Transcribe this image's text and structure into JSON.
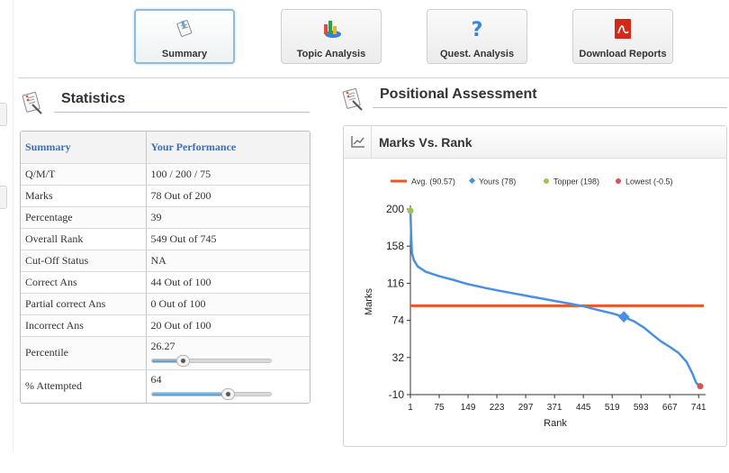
{
  "nav": [
    {
      "label": "Summary",
      "icon": "summary-icon",
      "active": true
    },
    {
      "label": "Topic Analysis",
      "icon": "topic-chart-icon",
      "active": false
    },
    {
      "label": "Quest. Analysis",
      "icon": "question-mark-icon",
      "active": false
    },
    {
      "label": "Download Reports",
      "icon": "pdf-icon",
      "active": false
    }
  ],
  "statistics": {
    "title": "Statistics",
    "header": {
      "col1": "Summary",
      "col2": "Your Performance"
    },
    "rows": [
      {
        "label": "Q/M/T",
        "value": "100 / 200 / 75"
      },
      {
        "label": "Marks",
        "value": "78 Out of 200"
      },
      {
        "label": "Percentage",
        "value": "39"
      },
      {
        "label": "Overall Rank",
        "value": "549 Out of 745"
      },
      {
        "label": "Cut-Off Status",
        "value": "NA"
      },
      {
        "label": "Correct Ans",
        "value": "44 Out of 100"
      },
      {
        "label": "Partial correct Ans",
        "value": "0 Out of 100"
      },
      {
        "label": "Incorrect Ans",
        "value": "20 Out of 100"
      }
    ],
    "sliders": [
      {
        "label": "Percentile",
        "value": "26.27",
        "fraction": 0.2627
      },
      {
        "label": "% Attempted",
        "value": "64",
        "fraction": 0.64
      }
    ]
  },
  "positional": {
    "title": "Positional Assessment",
    "panel_title": "Marks Vs. Rank"
  },
  "colors": {
    "avg": "#e8562a",
    "yours": "#4a8fe0",
    "topper": "#9cc35a",
    "lowest": "#d9534f",
    "link": "#3b6fb8"
  },
  "chart_data": {
    "type": "line",
    "xlabel": "Rank",
    "ylabel": "Marks",
    "xlim": [
      1,
      745
    ],
    "ylim": [
      -10,
      200
    ],
    "x_ticks": [
      "1",
      "75",
      "149",
      "223",
      "297",
      "371",
      "445",
      "519",
      "593",
      "667",
      "741"
    ],
    "y_ticks": [
      "200",
      "158",
      "116",
      "74",
      "32",
      "-10"
    ],
    "legend": [
      {
        "name": "Avg. (90.57)"
      },
      {
        "name": "Yours (78)"
      },
      {
        "name": "Topper (198)"
      },
      {
        "name": "Lowest (-0.5)"
      }
    ],
    "avg": 90.57,
    "yours": {
      "rank": 549,
      "marks": 78
    },
    "topper": {
      "rank": 1,
      "marks": 198
    },
    "lowest": {
      "rank": 745,
      "marks": -0.5
    },
    "curve": [
      [
        1,
        198
      ],
      [
        3,
        170
      ],
      [
        5,
        150
      ],
      [
        10,
        142
      ],
      [
        20,
        135
      ],
      [
        40,
        129
      ],
      [
        75,
        124
      ],
      [
        110,
        120
      ],
      [
        149,
        115
      ],
      [
        190,
        111
      ],
      [
        223,
        108
      ],
      [
        260,
        105
      ],
      [
        297,
        102
      ],
      [
        335,
        99
      ],
      [
        371,
        96
      ],
      [
        410,
        93
      ],
      [
        445,
        90
      ],
      [
        480,
        86
      ],
      [
        519,
        82
      ],
      [
        549,
        78
      ],
      [
        575,
        73
      ],
      [
        600,
        66
      ],
      [
        625,
        57
      ],
      [
        645,
        50
      ],
      [
        667,
        44
      ],
      [
        690,
        37
      ],
      [
        710,
        27
      ],
      [
        725,
        14
      ],
      [
        735,
        3
      ],
      [
        741,
        1
      ],
      [
        745,
        -0.5
      ]
    ]
  }
}
